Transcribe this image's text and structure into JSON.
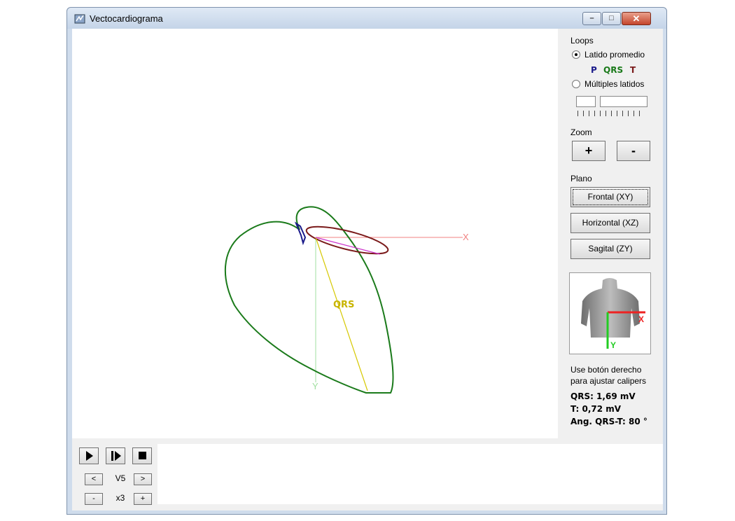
{
  "window": {
    "title": "Vectocardiograma",
    "controls": {
      "minimize": "–",
      "maximize": "□",
      "close": "✕"
    }
  },
  "canvas": {
    "axis_x_label": "X",
    "axis_y_label": "Y",
    "qrs_label": "QRS",
    "colors": {
      "qrs_loop": "#1a7a1a",
      "t_loop": "#7a1a1a",
      "p_loop": "#1a1a8a",
      "qrs_vector": "#d6c800",
      "t_vector": "#cc33cc",
      "x_axis": "#f08080",
      "y_axis": "#9fdf9f"
    }
  },
  "panel": {
    "loops_title": "Loops",
    "latido_promedio": "Latido promedio",
    "legend": {
      "p": "P",
      "qrs": "QRS",
      "t": "T",
      "p_color": "#1a1a8a",
      "qrs_color": "#1a7a1a",
      "t_color": "#7a1a1a"
    },
    "multiples_latidos": "Múltiples latidos",
    "zoom_title": "Zoom",
    "zoom_in": "+",
    "zoom_out": "-",
    "plano_title": "Plano",
    "frontal": "Frontal (XY)",
    "horizontal": "Horizontal (XZ)",
    "sagital": "Sagital (ZY)",
    "torso_x": "X",
    "torso_y": "Y",
    "help_line1": "Use botón derecho",
    "help_line2": "para ajustar calipers",
    "qrs_value": "QRS: 1,69 mV",
    "t_value": "T: 0,72 mV",
    "angle_value": "Ang. QRS-T: 80 °"
  },
  "bottom": {
    "lead_prev": "<",
    "lead": "V5",
    "lead_next": ">",
    "scale_minus": "-",
    "scale": "x3",
    "scale_plus": "+"
  }
}
